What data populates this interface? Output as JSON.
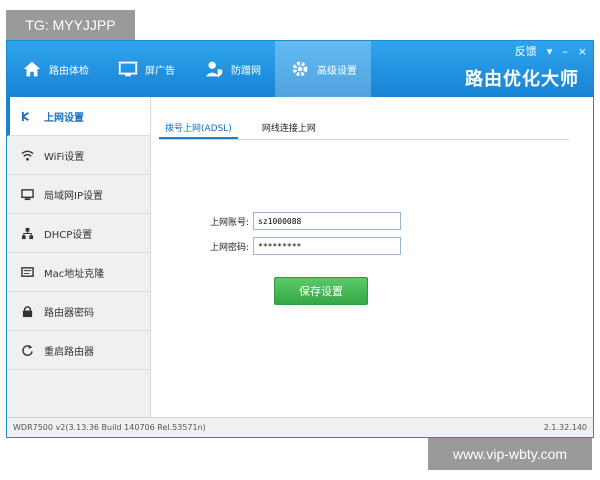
{
  "watermarks": {
    "top": "TG: MYYJJPP",
    "bottom": "www.vip-wbty.com"
  },
  "window_controls": {
    "feedback": "反馈",
    "dropdown": "▾",
    "minimize": "–",
    "close": "×"
  },
  "nav": {
    "items": [
      {
        "label": "路由体检",
        "icon": "home-icon"
      },
      {
        "label": "屏广告",
        "icon": "monitor-icon"
      },
      {
        "label": "防蹭网",
        "icon": "user-shield-icon"
      },
      {
        "label": "高级设置",
        "icon": "gear-icon",
        "active": true
      }
    ],
    "brand": "路由优化大师"
  },
  "sidebar": {
    "items": [
      {
        "label": "上网设置",
        "icon": "network-icon",
        "active": true
      },
      {
        "label": "WiFi设置",
        "icon": "wifi-icon"
      },
      {
        "label": "局域网IP设置",
        "icon": "lan-icon"
      },
      {
        "label": "DHCP设置",
        "icon": "dhcp-icon"
      },
      {
        "label": "Mac地址克隆",
        "icon": "mac-icon"
      },
      {
        "label": "路由器密码",
        "icon": "lock-icon"
      },
      {
        "label": "重启路由器",
        "icon": "restart-icon"
      }
    ]
  },
  "tabs": [
    {
      "label": "拨号上网(ADSL)",
      "active": true
    },
    {
      "label": "网线连接上网"
    }
  ],
  "form": {
    "account_label": "上网账号:",
    "account_value": "sz1000088",
    "password_label": "上网密码:",
    "password_value": "*********",
    "save_label": "保存设置"
  },
  "status": {
    "left": "WDR7500 v2(3.13.36 Build 140706 Rel.53571n)",
    "right": "2.1.32.140"
  },
  "colors": {
    "accent": "#1a80d4",
    "save": "#3ab04a"
  }
}
